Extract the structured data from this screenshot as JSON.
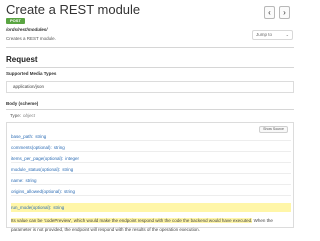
{
  "header": {
    "title": "Create a REST module",
    "prev_icon": "‹",
    "next_icon": "›"
  },
  "endpoint": {
    "method": "POST",
    "path": "/ords/rest/modules/",
    "description": "Creates a REST module."
  },
  "jump_to": {
    "selected": "Jump to",
    "chevron": "⌄"
  },
  "request": {
    "heading": "Request",
    "media_types_label": "Supported Media Types",
    "media_type": "application/json",
    "body_label": "Body (scheme)",
    "type_label": "Type:",
    "type_value": "object"
  },
  "schema": {
    "show_source_label": "Show Source",
    "properties": [
      {
        "name": "base_path:",
        "type": "string"
      },
      {
        "name": "comments(optional):",
        "type": "string"
      },
      {
        "name": "items_per_page(optional):",
        "type": "integer"
      },
      {
        "name": "module_status(optional):",
        "type": "string"
      },
      {
        "name": "name:",
        "type": "string"
      },
      {
        "name": "origins_allowed(optional):",
        "type": "string"
      }
    ],
    "highlighted_property": {
      "name": "run_mode(optional):",
      "type": "string"
    },
    "highlighted_description": "Its value can be 'codePreview', which would make the endpoint respond with the code the backend would have executed.",
    "description_rest": "When the parameter is not provided, the endpoint will respond with the results of the operation execution."
  }
}
